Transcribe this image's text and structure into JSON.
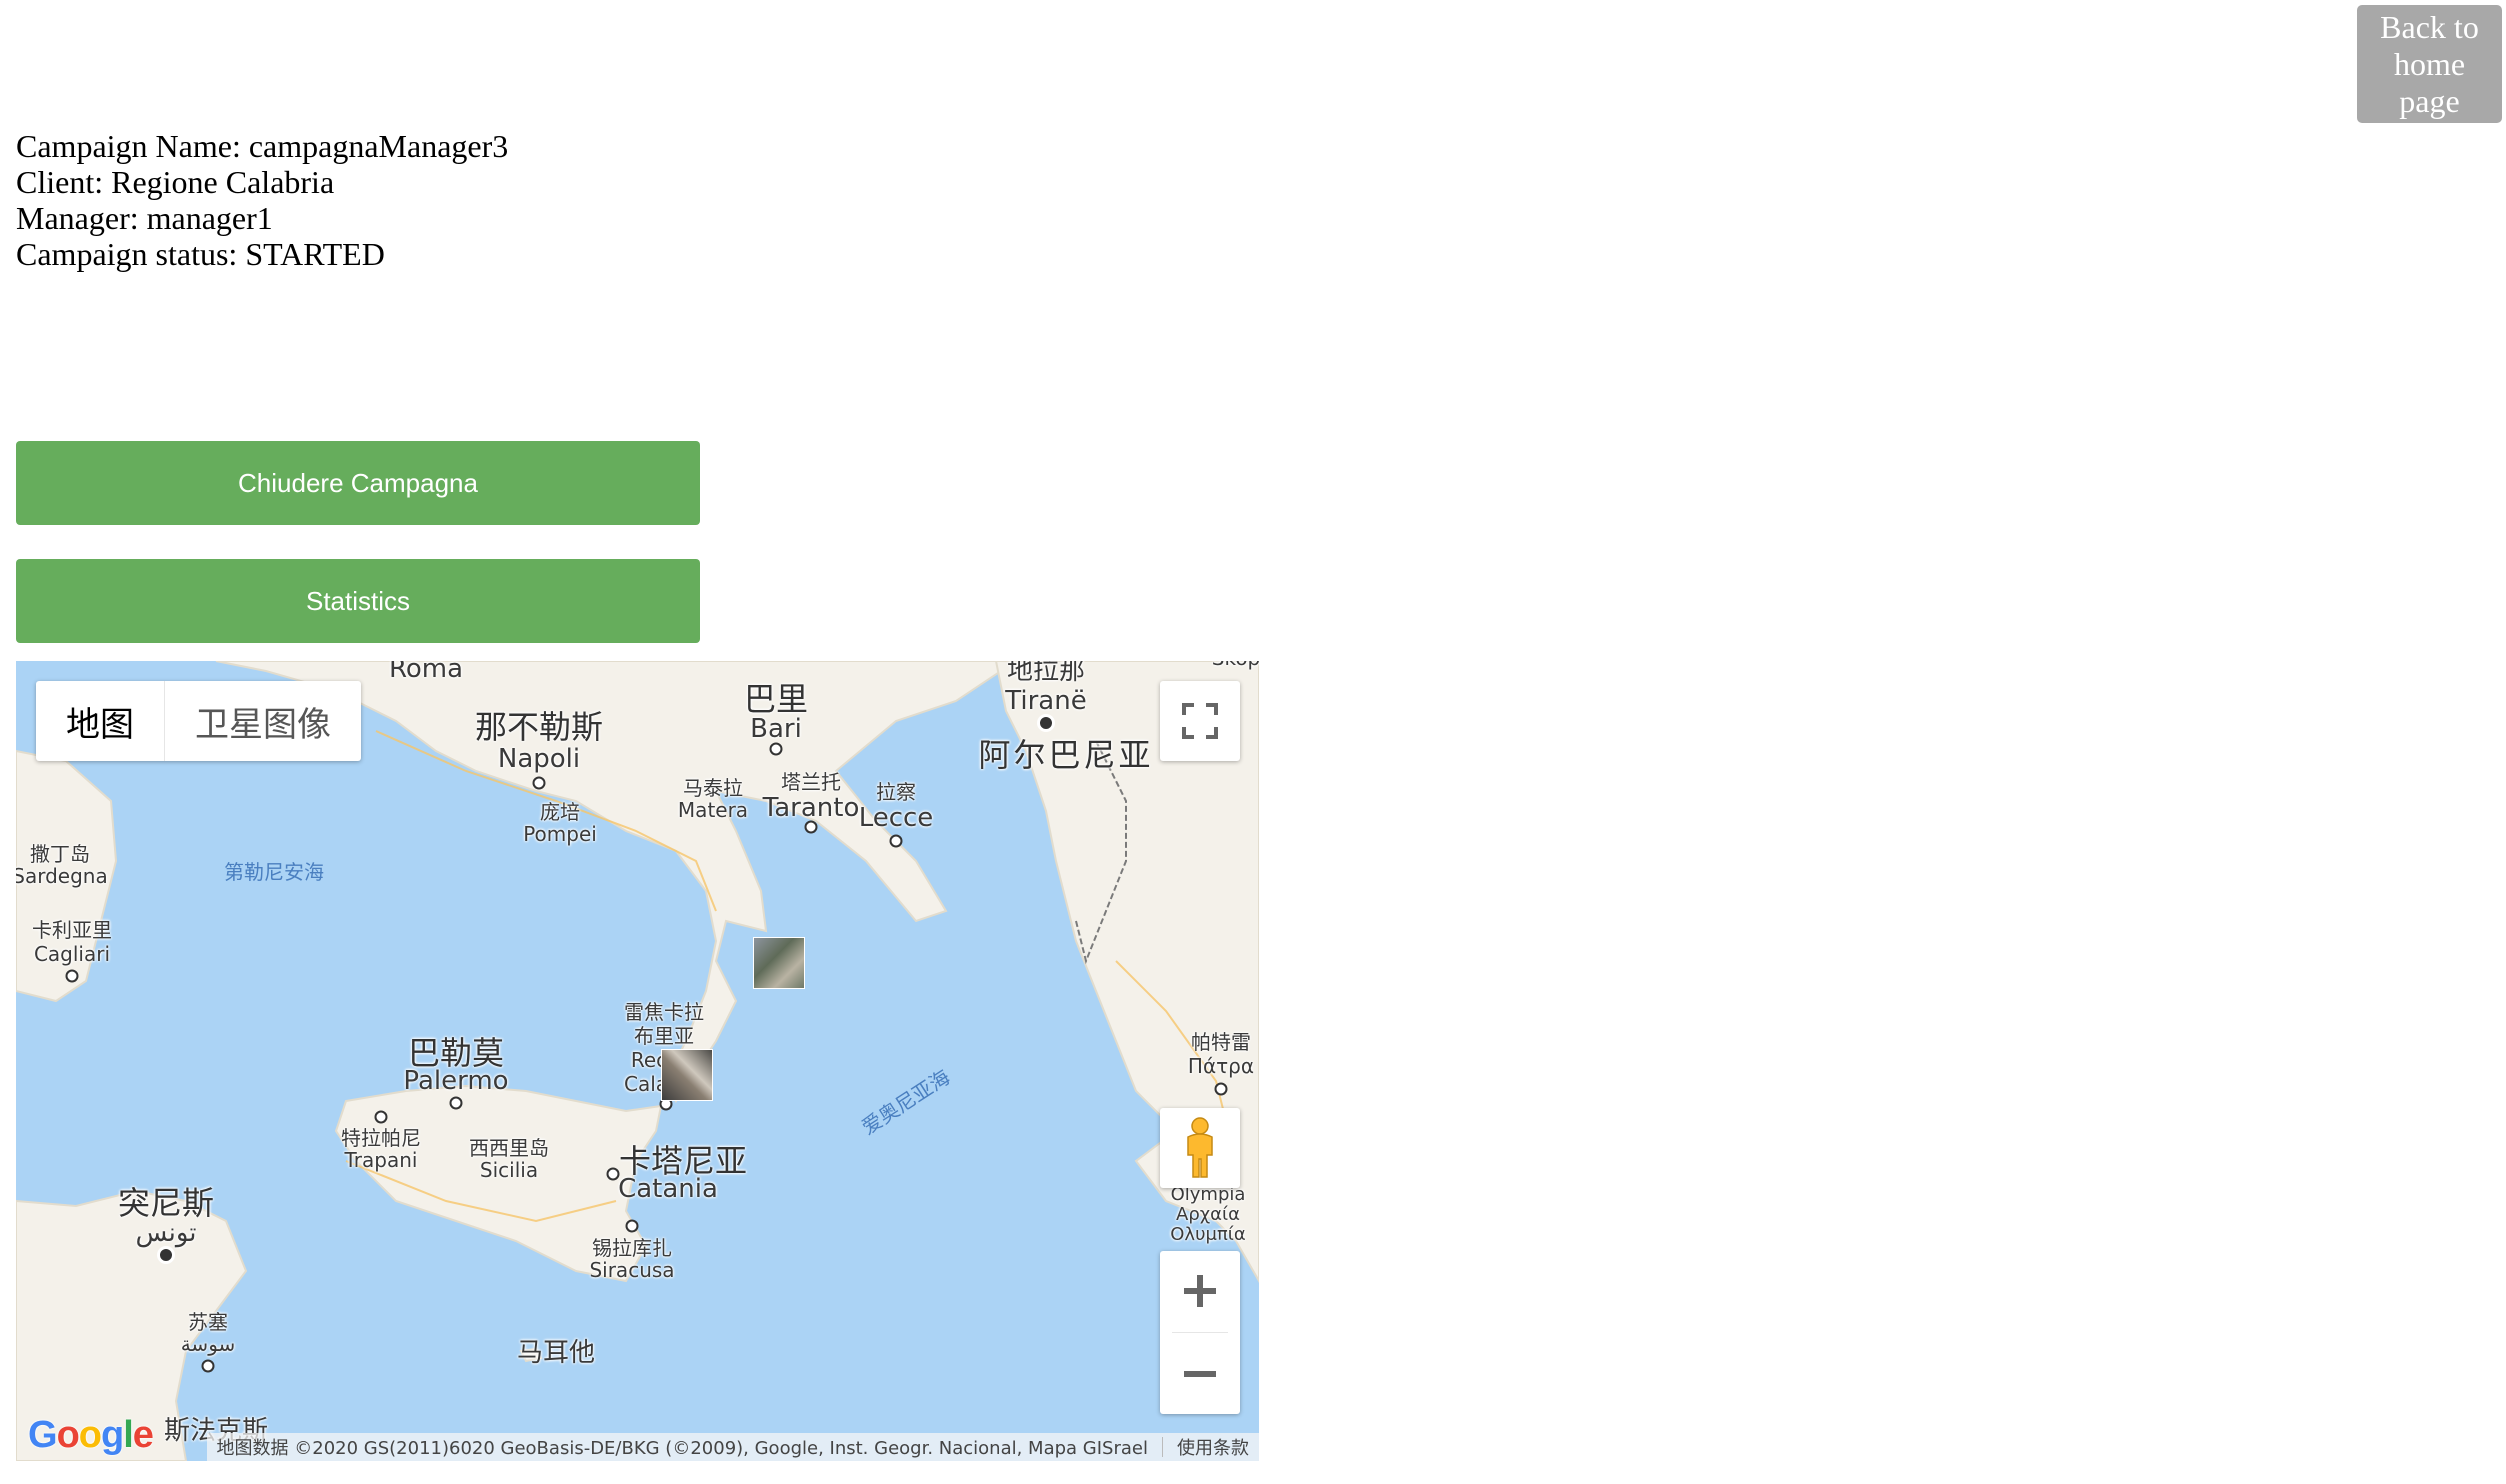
{
  "header": {
    "home_button_label": "Back to home page"
  },
  "campaign": {
    "name_label": "Campaign Name:",
    "name": "campagnaManager3",
    "client_label": "Client:",
    "client": "Regione Calabria",
    "manager_label": "Manager:",
    "manager": "manager1",
    "status_label": "Campaign status:",
    "status": "STARTED"
  },
  "actions": {
    "close_label": "Chiudere Campagna",
    "stats_label": "Statistics"
  },
  "map": {
    "map_type_options": [
      "地图",
      "卫星图像"
    ],
    "selected_map_type": "地图",
    "labels": {
      "roma": "Roma",
      "napoli_cn": "那不勒斯",
      "napoli": "Napoli",
      "pompei_cn": "庞培",
      "pompei": "Pompei",
      "bari_cn": "巴里",
      "bari": "Bari",
      "matera_cn": "马泰拉",
      "matera": "Matera",
      "taranto_cn": "塔兰托",
      "taranto": "Taranto",
      "lecce_cn": "拉察",
      "lecce": "Lecce",
      "tirane_cn": "地拉那",
      "tirane": "Tiranë",
      "albania": "阿尔巴尼亚",
      "sardegna_cn": "撒丁岛",
      "sardegna": "Sardegna",
      "cagliari_cn": "卡利亚里",
      "cagliari": "Cagliari",
      "tyrrhenian": "第勒尼安海",
      "reggio_cn1": "雷焦卡拉",
      "reggio_cn2": "布里亚",
      "reggio": "Rec",
      "reggio2": "Cala",
      "palermo_cn": "巴勒莫",
      "palermo": "Palermo",
      "trapani_cn": "特拉帕尼",
      "trapani": "Trapani",
      "sicilia_cn": "西西里岛",
      "sicilia": "Sicilia",
      "catania_cn": "卡塔尼亚",
      "catania": "Catania",
      "siracusa_cn": "锡拉库扎",
      "siracusa": "Siracusa",
      "ionian": "爱奥尼亚海",
      "tunis_cn": "突尼斯",
      "tunis_ar": "تونس",
      "sousse_cn": "苏塞",
      "sousse_ar": "سوسة",
      "malta": "马耳他",
      "patra_cn": "帕特雷",
      "patra": "Πάτρα",
      "olympia1": "Olympia",
      "olympia2": "Αρχαία",
      "olympia3": "Ολυμπία",
      "sfax_cn": "斯法克斯",
      "skopje_partial": "Skop"
    },
    "attribution": "地图数据 ©2020 GS(2011)6020 GeoBasis-DE/BKG (©2009), Google, Inst. Geogr. Nacional, Mapa GISrael",
    "terms": "使用条款",
    "logo_letters": [
      "G",
      "o",
      "o",
      "g",
      "l",
      "e"
    ],
    "logo_colors": [
      "#4285f4",
      "#ea4335",
      "#fbbc05",
      "#4285f4",
      "#34a853",
      "#ea4335"
    ],
    "land_color": "#f4f1ea",
    "sea_color": "#abd3f5"
  },
  "colors": {
    "primary_button": "#66ad5c",
    "home_button": "#a8a8a8"
  }
}
